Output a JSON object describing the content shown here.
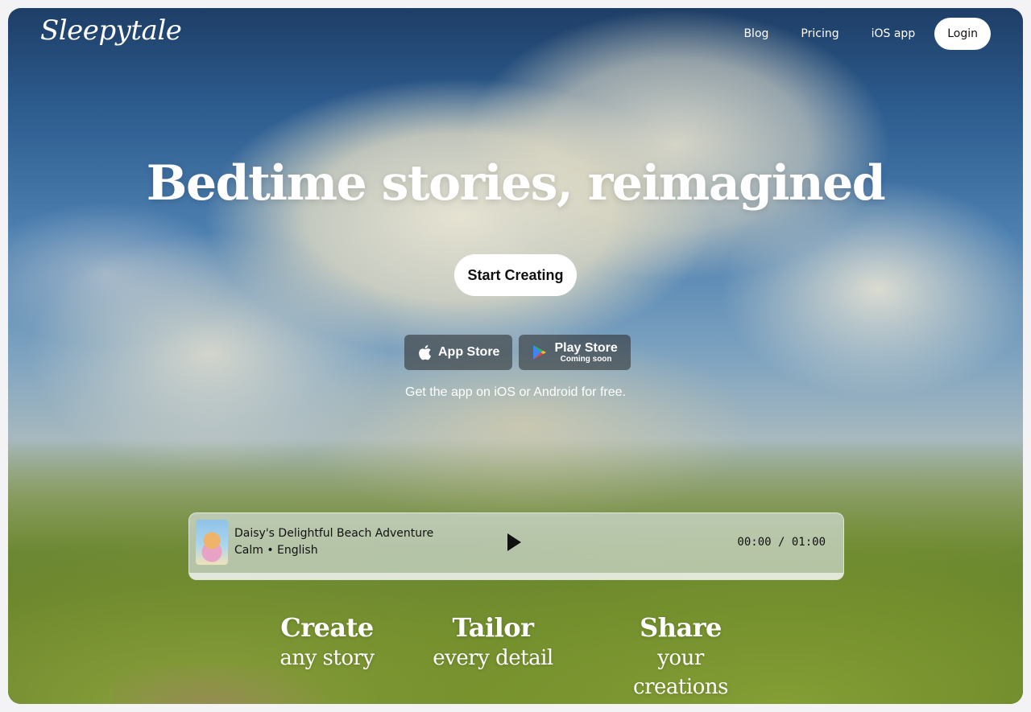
{
  "brand": {
    "name": "Sleepytale"
  },
  "nav": {
    "items": [
      {
        "label": "Blog"
      },
      {
        "label": "Pricing"
      },
      {
        "label": "iOS app"
      }
    ],
    "login_label": "Login"
  },
  "hero": {
    "title": "Bedtime stories, reimagined",
    "cta_label": "Start Creating",
    "app_store_label": "App Store",
    "play_store_label": "Play Store",
    "play_store_sub": "Coming soon",
    "note": "Get the app on iOS or Android for free."
  },
  "player": {
    "title": "Daisy's Delightful Beach Adventure",
    "meta": "Calm • English",
    "time": "00:00 / 01:00",
    "progress": 0
  },
  "features": [
    {
      "title": "Create",
      "subtitle": "any story"
    },
    {
      "title": "Tailor",
      "subtitle": "every detail"
    },
    {
      "title": "Share",
      "subtitle": "your creations"
    }
  ],
  "colors": {
    "accent_button": "#ffffff",
    "text": "#111111"
  },
  "icons": {
    "apple": "apple-icon",
    "play_store": "google-play-icon",
    "play": "play-icon"
  }
}
